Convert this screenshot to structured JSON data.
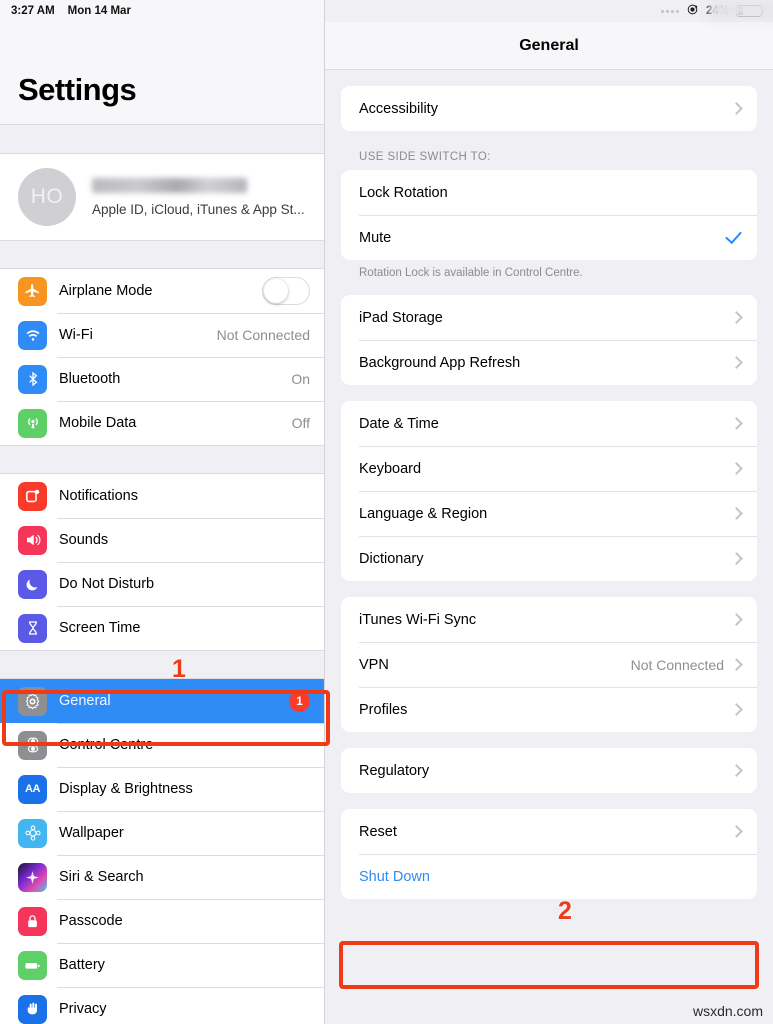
{
  "status_bar": {
    "time": "3:27 AM",
    "date": "Mon 14 Mar",
    "battery_percent": "24%",
    "battery_level": 24,
    "rotation_lock_icon": "rotation-lock-icon",
    "signal_dots_icon": "signal-dots-icon"
  },
  "sidebar": {
    "title": "Settings",
    "profile": {
      "initials": "HO",
      "name": "",
      "subtitle": "Apple ID, iCloud, iTunes & App St..."
    },
    "groups": [
      {
        "items": [
          {
            "label": "Airplane Mode",
            "icon": "airplane-icon",
            "color": "#f89521",
            "control": "toggle",
            "toggle_on": false
          },
          {
            "label": "Wi-Fi",
            "icon": "wifi-icon",
            "color": "#2f8bf5",
            "value": "Not Connected"
          },
          {
            "label": "Bluetooth",
            "icon": "bluetooth-icon",
            "color": "#2f8bf5",
            "value": "On"
          },
          {
            "label": "Mobile Data",
            "icon": "mobile-data-icon",
            "color": "#5fd068",
            "value": "Off"
          }
        ]
      },
      {
        "items": [
          {
            "label": "Notifications",
            "icon": "notifications-icon",
            "color": "#f93b2c"
          },
          {
            "label": "Sounds",
            "icon": "sounds-icon",
            "color": "#f6355b"
          },
          {
            "label": "Do Not Disturb",
            "icon": "moon-icon",
            "color": "#5a5ae6"
          },
          {
            "label": "Screen Time",
            "icon": "hourglass-icon",
            "color": "#5a5ae6"
          }
        ]
      },
      {
        "items": [
          {
            "label": "General",
            "icon": "gear-icon",
            "color": "#8e8e93",
            "selected": true,
            "badge": "1"
          },
          {
            "label": "Control Centre",
            "icon": "control-centre-icon",
            "color": "#8e8e93"
          },
          {
            "label": "Display & Brightness",
            "icon": "display-brightness-icon",
            "color": "#1b72e8"
          },
          {
            "label": "Wallpaper",
            "icon": "wallpaper-icon",
            "color": "#43b6f2"
          },
          {
            "label": "Siri & Search",
            "icon": "siri-icon",
            "color": "#2a2140"
          },
          {
            "label": "Passcode",
            "icon": "lock-icon",
            "color": "#f6355b"
          },
          {
            "label": "Battery",
            "icon": "battery-icon",
            "color": "#5fd068"
          },
          {
            "label": "Privacy",
            "icon": "privacy-hand-icon",
            "color": "#1b72e8"
          }
        ]
      }
    ]
  },
  "detail": {
    "nav_title": "General",
    "sections": [
      {
        "header": "",
        "footer": "",
        "rows": [
          {
            "label": "Accessibility",
            "accessory": "chevron"
          }
        ]
      },
      {
        "header": "USE SIDE SWITCH TO:",
        "footer": "Rotation Lock is available in Control Centre.",
        "rows": [
          {
            "label": "Lock Rotation",
            "accessory": "none"
          },
          {
            "label": "Mute",
            "accessory": "check"
          }
        ]
      },
      {
        "header": "",
        "footer": "",
        "rows": [
          {
            "label": "iPad Storage",
            "accessory": "chevron"
          },
          {
            "label": "Background App Refresh",
            "accessory": "chevron"
          }
        ]
      },
      {
        "header": "",
        "footer": "",
        "rows": [
          {
            "label": "Date & Time",
            "accessory": "chevron"
          },
          {
            "label": "Keyboard",
            "accessory": "chevron"
          },
          {
            "label": "Language & Region",
            "accessory": "chevron"
          },
          {
            "label": "Dictionary",
            "accessory": "chevron"
          }
        ]
      },
      {
        "header": "",
        "footer": "",
        "rows": [
          {
            "label": "iTunes Wi-Fi Sync",
            "accessory": "chevron"
          },
          {
            "label": "VPN",
            "value": "Not Connected",
            "accessory": "chevron"
          },
          {
            "label": "Profiles",
            "accessory": "chevron"
          }
        ]
      },
      {
        "header": "",
        "footer": "",
        "rows": [
          {
            "label": "Regulatory",
            "accessory": "chevron"
          }
        ]
      },
      {
        "header": "",
        "footer": "",
        "rows": [
          {
            "label": "Reset",
            "accessory": "chevron"
          },
          {
            "label": "Shut Down",
            "accessory": "none",
            "style": "link"
          }
        ]
      }
    ]
  },
  "annotations": {
    "step1": "1",
    "step2": "2",
    "accent_color": "#ef3a17"
  },
  "watermark": "wsxdn.com"
}
